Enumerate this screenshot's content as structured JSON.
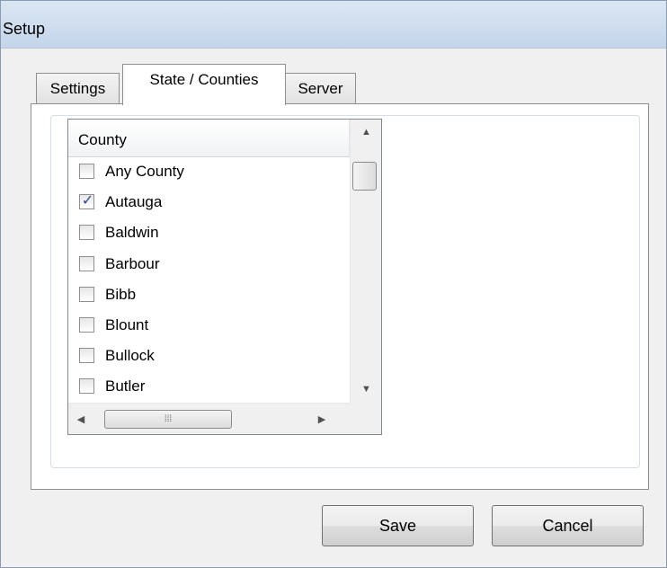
{
  "window": {
    "title": "Setup"
  },
  "tabs": [
    {
      "label": "Settings"
    },
    {
      "label": "State / Counties",
      "active": true
    },
    {
      "label": "Server"
    }
  ],
  "county_list": {
    "column_header": "County",
    "items": [
      {
        "label": "Any County",
        "checked": false
      },
      {
        "label": "Autauga",
        "checked": true
      },
      {
        "label": "Baldwin",
        "checked": false
      },
      {
        "label": "Barbour",
        "checked": false
      },
      {
        "label": "Bibb",
        "checked": false
      },
      {
        "label": "Blount",
        "checked": false
      },
      {
        "label": "Bullock",
        "checked": false
      },
      {
        "label": "Butler",
        "checked": false
      }
    ]
  },
  "buttons": {
    "save": "Save",
    "cancel": "Cancel"
  }
}
